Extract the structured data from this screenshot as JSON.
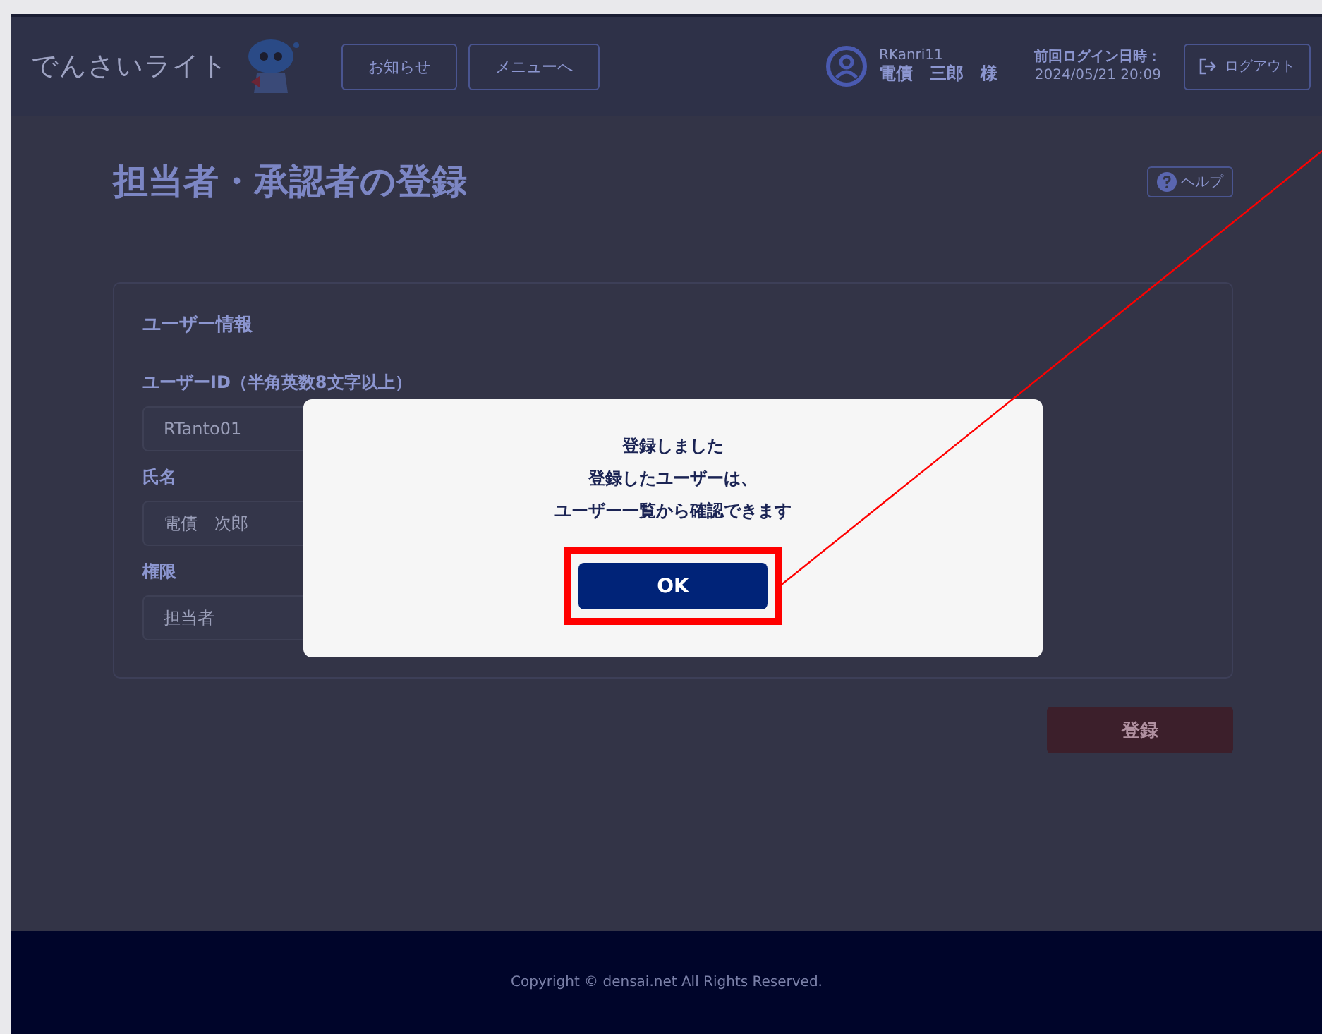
{
  "header": {
    "logo": "でんさいライト",
    "buttons": [
      {
        "label": "お知らせ"
      },
      {
        "label": "メニューへ"
      }
    ],
    "user": {
      "id": "RKanri11",
      "name": "電債　三郎　様"
    },
    "last_login": {
      "label": "前回ログイン日時：",
      "value": "2024/05/21 20:09"
    },
    "logout": "ログアウト"
  },
  "page": {
    "title": "担当者・承認者の登録",
    "help": "ヘルプ"
  },
  "form": {
    "section": "ユーザー情報",
    "fields": [
      {
        "label": "ユーザーID（半角英数8文字以上）",
        "value": "RTanto01"
      },
      {
        "label": "氏名",
        "value": "電債　次郎"
      },
      {
        "label": "権限",
        "value": "担当者"
      }
    ],
    "submit": "登録"
  },
  "dialog": {
    "lines": [
      "登録しました",
      "登録したユーザーは、",
      "ユーザー一覧から確認できます"
    ],
    "button": "OK"
  },
  "footer": "Copyright © densai.net All Rights Reserved."
}
